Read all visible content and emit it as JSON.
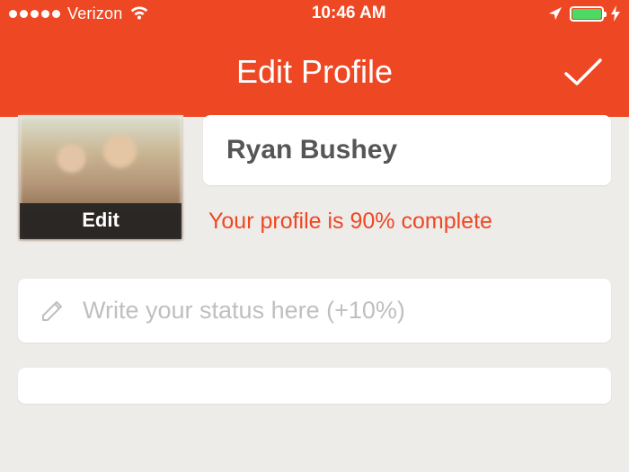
{
  "statusBar": {
    "carrier": "Verizon",
    "time": "10:46 AM"
  },
  "nav": {
    "title": "Edit Profile"
  },
  "avatar": {
    "editLabel": "Edit"
  },
  "profile": {
    "name": "Ryan Bushey",
    "completionText": "Your profile is 90% complete"
  },
  "statusInput": {
    "placeholder": "Write your status here (+10%)"
  },
  "colors": {
    "accent": "#ee4723"
  }
}
